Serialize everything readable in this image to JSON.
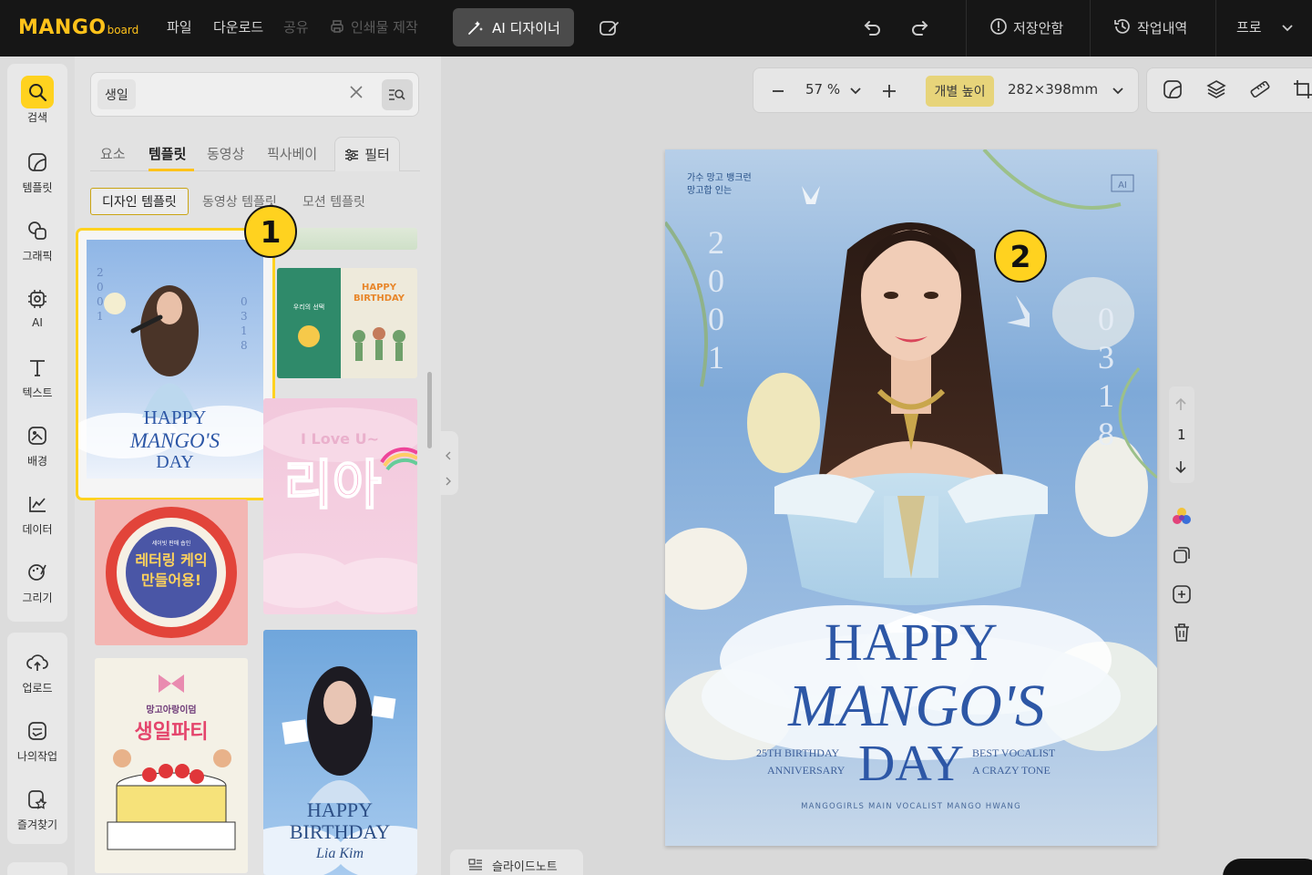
{
  "app": {
    "logo_main": "MANGO",
    "logo_sub": "board"
  },
  "topbar": {
    "file": "파일",
    "download": "다운로드",
    "share": "공유",
    "print": "인쇄물 제작",
    "ai_designer": "AI 디자이너",
    "save_status": "저장안함",
    "history": "작업내역",
    "account": "프로"
  },
  "rail": {
    "items": [
      {
        "label": "검색",
        "icon": "search-icon"
      },
      {
        "label": "템플릿",
        "icon": "template-icon"
      },
      {
        "label": "그래픽",
        "icon": "graphic-icon"
      },
      {
        "label": "AI",
        "icon": "ai-icon"
      },
      {
        "label": "텍스트",
        "icon": "text-icon"
      },
      {
        "label": "배경",
        "icon": "background-icon"
      },
      {
        "label": "데이터",
        "icon": "chart-icon"
      },
      {
        "label": "그리기",
        "icon": "draw-icon"
      }
    ],
    "bottom_items": [
      {
        "label": "업로드",
        "icon": "upload-icon"
      },
      {
        "label": "나의작업",
        "icon": "my-work-icon"
      },
      {
        "label": "즐겨찾기",
        "icon": "favorite-icon"
      }
    ]
  },
  "panel": {
    "search_value": "생일",
    "tabs": [
      "요소",
      "템플릿",
      "동영상",
      "픽사베이"
    ],
    "active_tab": "템플릿",
    "filter": "필터",
    "subtabs": [
      "디자인 템플릿",
      "동영상 템플릿",
      "모션 템플릿"
    ],
    "cards": {
      "mango": {
        "line1": "HAPPY",
        "line2": "MANGO'S",
        "line3": "DAY",
        "side_left": "2 0 0 1",
        "side_right": "0 3 1 8"
      },
      "birthday_teal": {
        "title": "HAPPY BIRTHDAY",
        "subtitle": "우리의 선택"
      },
      "pink_rainbow": {
        "big": "리아",
        "small": "I Love U~"
      },
      "cake_circle": {
        "line1": "레터링 케익",
        "line2": "만들어용!",
        "small": "세이빗 판매 숍인"
      },
      "party_cake": {
        "top": "망고아랑이덤",
        "title": "생일파티"
      },
      "lia_kim": {
        "line1": "HAPPY",
        "line2": "BIRTHDAY",
        "sign": "Lia Kim"
      }
    }
  },
  "badges": {
    "first": "1",
    "second": "2"
  },
  "zoom": {
    "value": "57 %",
    "height_btn": "개별 높이",
    "size": "282×398mm"
  },
  "poster": {
    "top_left_line1": "가수 망고 뱅크런",
    "top_left_line2": "망고합 인는",
    "top_right": "AI",
    "year_digits": [
      "2",
      "0",
      "0",
      "1"
    ],
    "date_digits": [
      "0",
      "3",
      "1",
      "8"
    ],
    "happy": "HAPPY",
    "mangos": "MANGO'S",
    "day": "DAY",
    "left_sub1": "25TH BIRTHDAY",
    "left_sub2": "ANNIVERSARY",
    "right_sub1": "BEST VOCALIST",
    "right_sub2": "A CRAZY TONE",
    "footer": "MANGOGIRLS MAIN VOCALIST MANGO HWANG"
  },
  "pager": {
    "current": "1"
  },
  "slide_note": "슬라이드노트",
  "colors": {
    "accent": "#ffd21f",
    "topbar": "#161616",
    "poster_title": "#2d57a6"
  }
}
